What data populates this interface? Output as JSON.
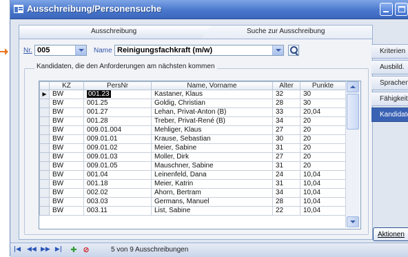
{
  "window": {
    "title": "Ausschreibung/Personensuche"
  },
  "colors": {
    "titlebar": "#4a77cc",
    "selected_tab": "#3a62b4",
    "arrow": "#e87722"
  },
  "tabs": [
    {
      "label": "Ausschreibung",
      "selected": false
    },
    {
      "label": "Suche zur Ausschreibung",
      "selected": true
    }
  ],
  "search": {
    "nr_label": "Nr.",
    "nr_value": "005",
    "name_label": "Name",
    "name_value": "Reinigungsfachkraft (m/w)",
    "search_icon": "magnifier-icon"
  },
  "group": {
    "title": "Kandidaten, die den Anforderungen am nächsten kommen"
  },
  "table": {
    "columns": [
      "KZ",
      "PersNr",
      "Name, Vorname",
      "Alter",
      "Punkte"
    ],
    "rows": [
      {
        "kz": "BW",
        "persnr": "001.23",
        "name": "Kastaner, Klaus",
        "alter": "32",
        "punkte": "30",
        "current": true
      },
      {
        "kz": "BW",
        "persnr": "001.25",
        "name": "Goldig, Christian",
        "alter": "28",
        "punkte": "30"
      },
      {
        "kz": "BW",
        "persnr": "001.27",
        "name": "Lehan, Privat-Anton (B)",
        "alter": "33",
        "punkte": "20,04"
      },
      {
        "kz": "BW",
        "persnr": "001.28",
        "name": "Treber, Privat-René (B)",
        "alter": "34",
        "punkte": "20"
      },
      {
        "kz": "BW",
        "persnr": "009.01.004",
        "name": "Mehliger, Klaus",
        "alter": "27",
        "punkte": "20"
      },
      {
        "kz": "BW",
        "persnr": "009.01.01",
        "name": "Krause, Sebastian",
        "alter": "30",
        "punkte": "20"
      },
      {
        "kz": "BW",
        "persnr": "009.01.02",
        "name": "Meier, Sabine",
        "alter": "31",
        "punkte": "20"
      },
      {
        "kz": "BW",
        "persnr": "009.01.03",
        "name": "Moller, Dirk",
        "alter": "27",
        "punkte": "20"
      },
      {
        "kz": "BW",
        "persnr": "009.01.05",
        "name": "Mauschner, Sabine",
        "alter": "31",
        "punkte": "20"
      },
      {
        "kz": "BW",
        "persnr": "001.04",
        "name": "Leinenfeld, Dana",
        "alter": "24",
        "punkte": "10,04"
      },
      {
        "kz": "BW",
        "persnr": "001.18",
        "name": "Meier, Katrin",
        "alter": "31",
        "punkte": "10,04"
      },
      {
        "kz": "BW",
        "persnr": "002.02",
        "name": "Ahorn, Bertram",
        "alter": "34",
        "punkte": "10,04"
      },
      {
        "kz": "BW",
        "persnr": "003.03",
        "name": "Germans, Manuel",
        "alter": "28",
        "punkte": "10,04"
      },
      {
        "kz": "BW",
        "persnr": "003.11",
        "name": "List, Sabine",
        "alter": "22",
        "punkte": "10,04"
      }
    ]
  },
  "side_tabs": [
    "Kriterien",
    "Ausbild.",
    "Sprachen",
    "Fähigkeiten",
    "Kandidaten"
  ],
  "actions": {
    "label": "Aktionen"
  },
  "status": {
    "text": "5 von 9 Ausschreibungen",
    "nav_icons": [
      "first-record-icon",
      "previous-record-icon",
      "next-record-icon",
      "last-record-icon",
      "add-record-icon",
      "delete-record-icon"
    ]
  }
}
